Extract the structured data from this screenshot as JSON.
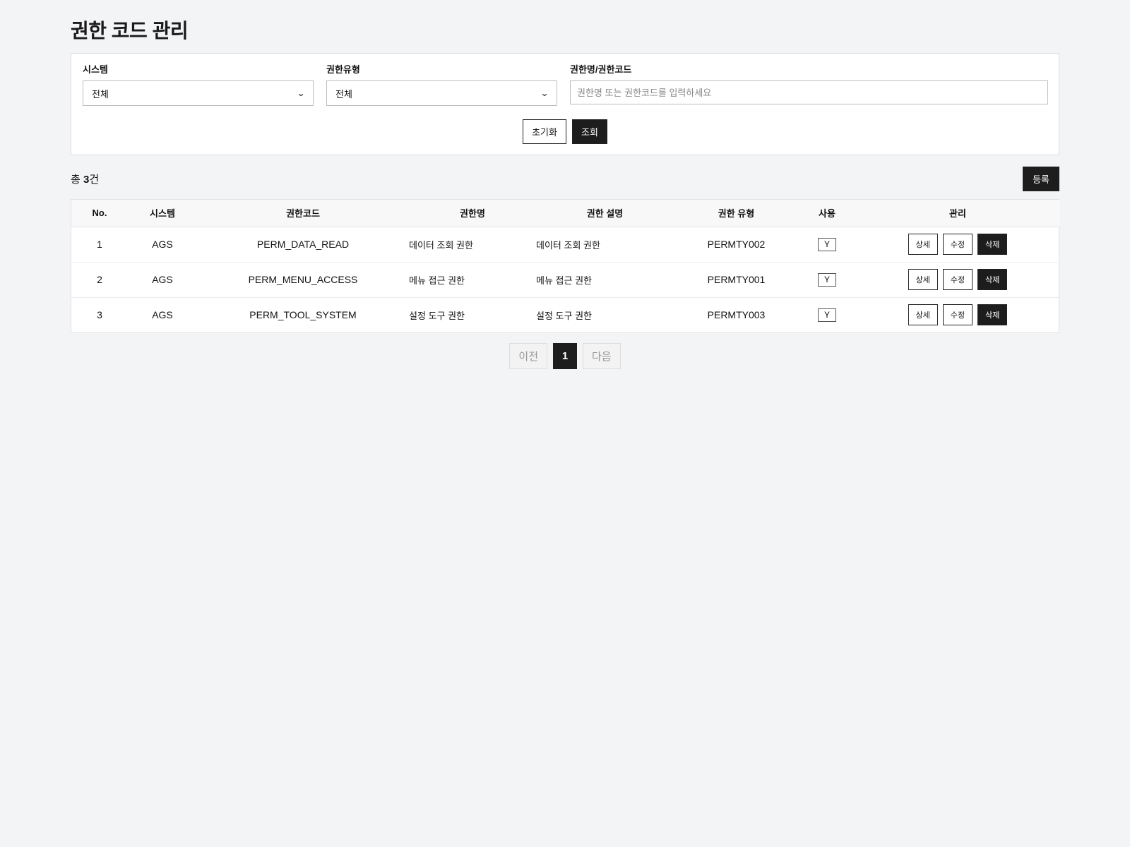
{
  "page": {
    "title": "권한 코드 관리"
  },
  "search": {
    "system_label": "시스템",
    "system_value": "전체",
    "type_label": "권한유형",
    "type_value": "전체",
    "keyword_label": "권한명/권한코드",
    "keyword_placeholder": "권한명 또는 권한코드를 입력하세요",
    "keyword_value": "",
    "reset_label": "초기화",
    "search_label": "조회"
  },
  "summary": {
    "prefix": "총 ",
    "count": "3",
    "suffix": "건",
    "register_label": "등록"
  },
  "table": {
    "headers": [
      "No.",
      "시스템",
      "권한코드",
      "권한명",
      "권한 설명",
      "권한 유형",
      "사용",
      "관리"
    ],
    "rows": [
      {
        "no": "1",
        "system": "AGS",
        "code": "PERM_DATA_READ",
        "name": "데이터 조회 권한",
        "desc": "데이터 조회 권한",
        "type": "PERMTY002",
        "use": "Y"
      },
      {
        "no": "2",
        "system": "AGS",
        "code": "PERM_MENU_ACCESS",
        "name": "메뉴 접근 권한",
        "desc": "메뉴 접근 권한",
        "type": "PERMTY001",
        "use": "Y"
      },
      {
        "no": "3",
        "system": "AGS",
        "code": "PERM_TOOL_SYSTEM",
        "name": "설정 도구 권한",
        "desc": "설정 도구 권한",
        "type": "PERMTY003",
        "use": "Y"
      }
    ],
    "actions": {
      "detail": "상세",
      "edit": "수정",
      "delete": "삭제"
    }
  },
  "pagination": {
    "prev": "이전",
    "current": "1",
    "next": "다음"
  },
  "icons": {
    "dropdown": "chevron-down-icon"
  },
  "colors": {
    "accent_dark": "#1d1d1d",
    "background": "#f3f4f6"
  }
}
